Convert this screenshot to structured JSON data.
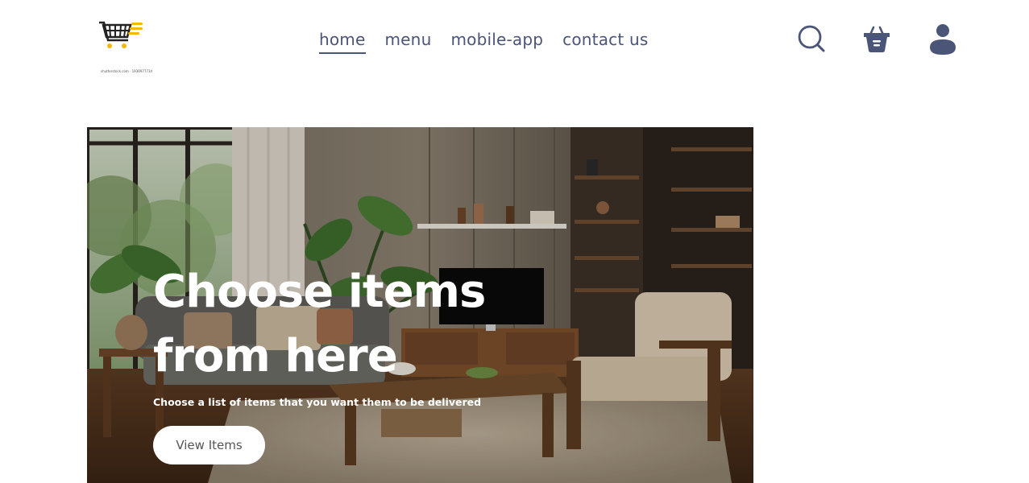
{
  "logo": {
    "caption": "shutterstock.com · 1930977734"
  },
  "nav": {
    "items": [
      {
        "label": "home",
        "active": true
      },
      {
        "label": "menu",
        "active": false
      },
      {
        "label": "mobile-app",
        "active": false
      },
      {
        "label": "contact us",
        "active": false
      }
    ]
  },
  "header_icons": [
    "search-icon",
    "cart-basket-icon",
    "user-icon"
  ],
  "hero": {
    "title": "Choose items from here",
    "subtitle": "Choose a list of items that you want them to be delivered",
    "button_label": "View Items"
  },
  "colors": {
    "nav_text": "#4a5578",
    "icon": "#4a5578",
    "logo_yellow": "#f5b800",
    "hero_text": "#ffffff",
    "button_bg": "#ffffff"
  }
}
